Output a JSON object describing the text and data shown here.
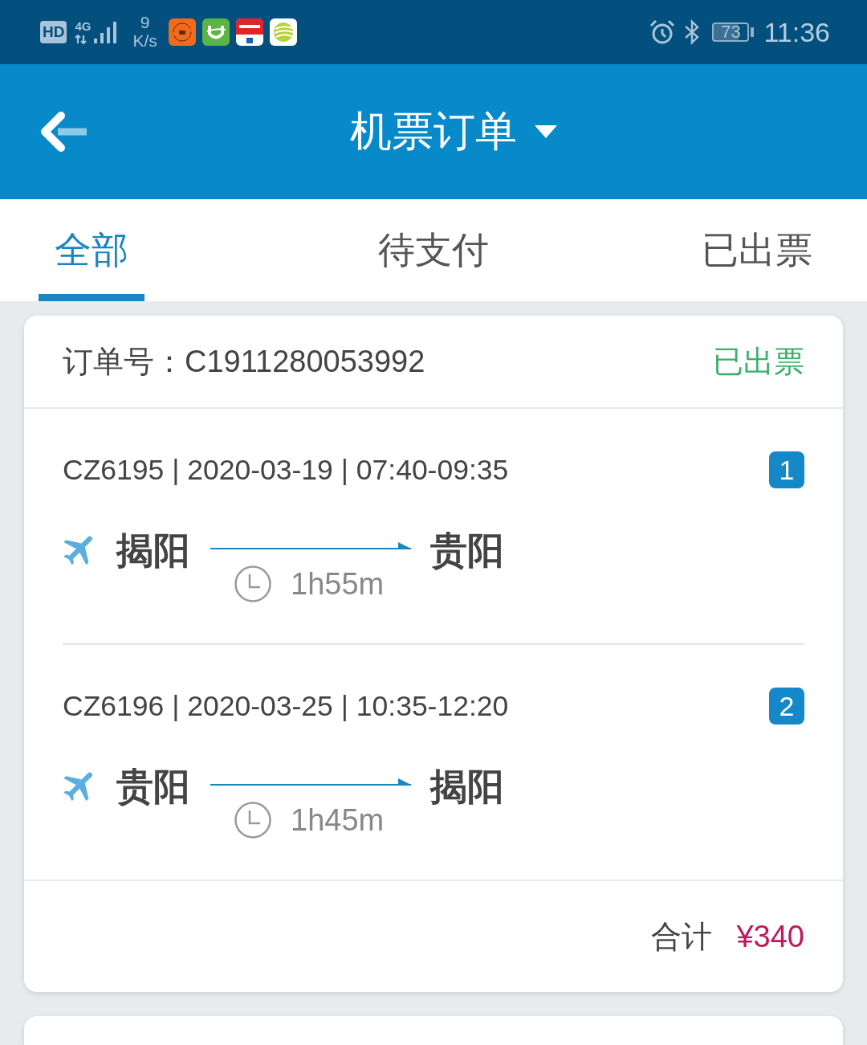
{
  "status_bar": {
    "hd_label": "HD",
    "network_type": "4G",
    "speed_value": "9",
    "speed_unit": "K/s",
    "battery": "73",
    "time": "11:36"
  },
  "header": {
    "title": "机票订单"
  },
  "tabs": [
    {
      "label": "全部",
      "selected": true
    },
    {
      "label": "待支付",
      "selected": false
    },
    {
      "label": "已出票",
      "selected": false
    }
  ],
  "orders": [
    {
      "order_number": "订单号：C1911280053992",
      "status": "已出票",
      "segments": [
        {
          "flight_info": "CZ6195 | 2020-03-19 | 07:40-09:35",
          "index": "1",
          "from": "揭阳",
          "to": "贵阳",
          "duration": "1h55m"
        },
        {
          "flight_info": "CZ6196 | 2020-03-25 | 10:35-12:20",
          "index": "2",
          "from": "贵阳",
          "to": "揭阳",
          "duration": "1h45m"
        }
      ],
      "total_label": "合计",
      "total": "¥340"
    }
  ]
}
